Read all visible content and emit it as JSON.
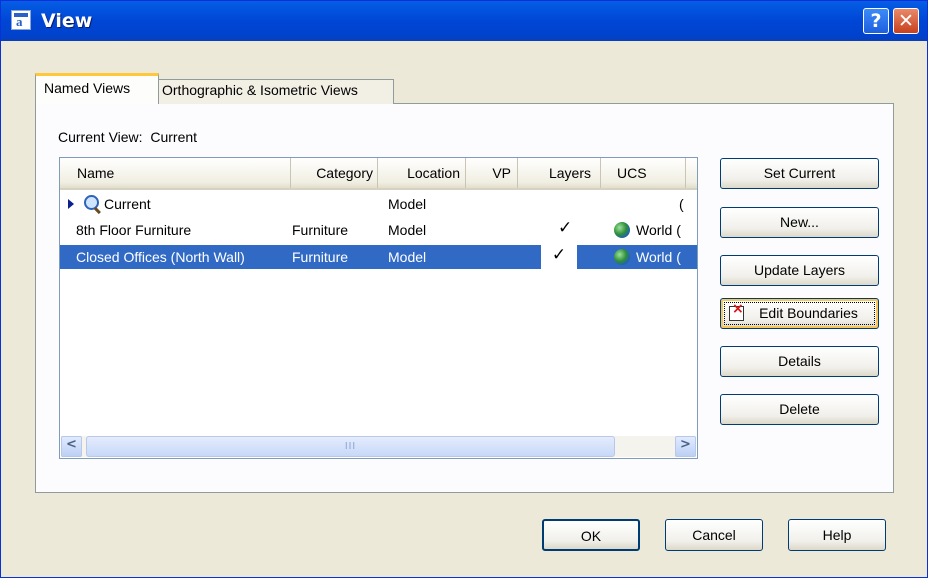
{
  "window": {
    "title": "View"
  },
  "tabs": [
    {
      "label": "Named Views",
      "active": true
    },
    {
      "label": "Orthographic & Isometric Views",
      "active": false
    }
  ],
  "current_view": {
    "label": "Current View:",
    "value": "Current"
  },
  "list": {
    "columns": [
      "Name",
      "Category",
      "Location",
      "VP",
      "Layers",
      "UCS"
    ],
    "rows": [
      {
        "name": "Current",
        "category": "",
        "location": "Model",
        "vp": "",
        "layers": "",
        "ucs": "("
      },
      {
        "name": "8th Floor Furniture",
        "category": "Furniture",
        "location": "Model",
        "vp": "",
        "layers": "✓",
        "ucs": "World ("
      },
      {
        "name": "Closed Offices (North Wall)",
        "category": "Furniture",
        "location": "Model",
        "vp": "",
        "layers": "✓",
        "ucs": "World (",
        "selected": true
      }
    ],
    "scroll_thumb_grip": "III"
  },
  "side_buttons": {
    "set_current": "Set Current",
    "new": "New...",
    "update_layers": "Update Layers",
    "edit_boundaries": "Edit Boundaries",
    "details": "Details",
    "delete": "Delete"
  },
  "bottom_buttons": {
    "ok": "OK",
    "cancel": "Cancel",
    "help": "Help"
  },
  "titlebar_buttons": {
    "help": "?",
    "close": "✕"
  },
  "scroll_arrows": {
    "left": "<",
    "right": ">"
  },
  "colors": {
    "title_bar": "#0046d6",
    "selection": "#316ac5",
    "dialog_bg": "#ece9d8",
    "tab_highlight": "#ffc83c"
  }
}
